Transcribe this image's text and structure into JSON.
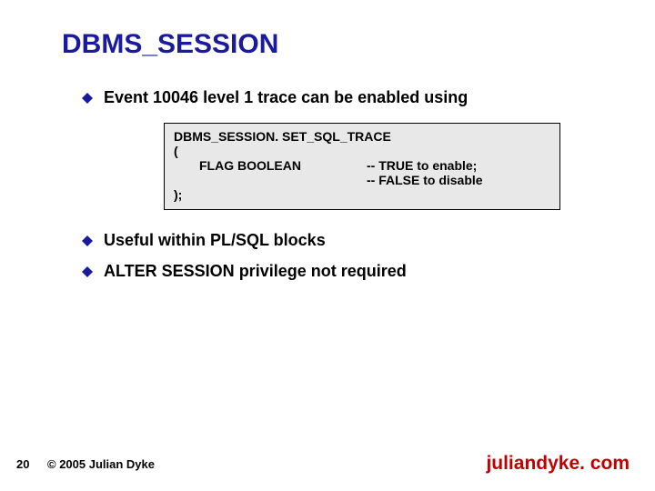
{
  "title": "DBMS_SESSION",
  "bullets": {
    "b1": "Event 10046 level 1 trace can be enabled using",
    "b2": "Useful within PL/SQL blocks",
    "b3_mono": "ALTER SESSION",
    "b3_rest": " privilege not required"
  },
  "code": {
    "line1": "DBMS_SESSION. SET_SQL_TRACE",
    "line2": "(",
    "param": "FLAG BOOLEAN",
    "comment1": "-- TRUE to enable;",
    "comment2": "-- FALSE to disable",
    "line5": ");"
  },
  "footer": {
    "page": "20",
    "copyright": "© 2005 Julian Dyke",
    "site": "juliandyke. com"
  },
  "colors": {
    "title": "#1a1a9e",
    "bullet_fill": "#1a1a9e",
    "site": "#c00000",
    "codebox_bg": "#e8e8e8"
  }
}
